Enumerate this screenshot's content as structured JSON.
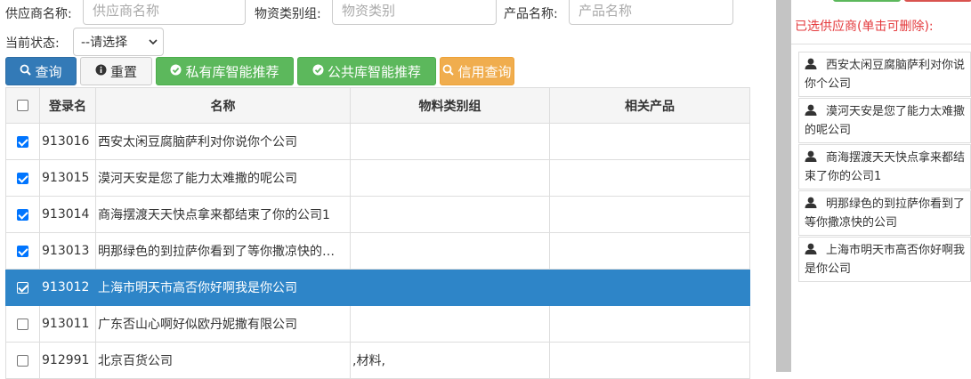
{
  "filters": {
    "supplier_label": "供应商名称:",
    "supplier_placeholder": "供应商名称",
    "material_group_label": "物资类别组:",
    "material_group_placeholder": "物资类别",
    "product_label": "产品名称:",
    "product_placeholder": "产品名称",
    "status_label": "当前状态:",
    "status_value": "--请选择"
  },
  "toolbar": {
    "query": "查询",
    "reset": "重置",
    "private_recommend": "私有库智能推荐",
    "public_recommend": "公共库智能推荐",
    "credit_query": "信用查询"
  },
  "table": {
    "headers": [
      "",
      "登录名",
      "名称",
      "物料类别组",
      "相关产品"
    ],
    "rows": [
      {
        "checked": true,
        "login": "913016",
        "name": "西安太闲豆腐脑萨利对你说你个公司",
        "group": "",
        "product": "",
        "selected": false
      },
      {
        "checked": true,
        "login": "913015",
        "name": "漠河天安是您了能力太难撒的呢公司",
        "group": "",
        "product": "",
        "selected": false
      },
      {
        "checked": true,
        "login": "913014",
        "name": "商海摆渡天天快点拿来都结束了你的公司1",
        "group": "",
        "product": "",
        "selected": false
      },
      {
        "checked": true,
        "login": "913013",
        "name": "明那绿色的到拉萨你看到了等你撒凉快的…",
        "group": "",
        "product": "",
        "selected": false
      },
      {
        "checked": true,
        "login": "913012",
        "name": "上海市明天市高否你好啊我是你公司",
        "group": "",
        "product": "",
        "selected": true
      },
      {
        "checked": false,
        "login": "913011",
        "name": "广东否山心啊好似欧丹妮撒有限公司",
        "group": "",
        "product": "",
        "selected": false
      },
      {
        "checked": false,
        "login": "912991",
        "name": "北京百货公司",
        "group": ",材料,",
        "product": "",
        "selected": false
      }
    ]
  },
  "right_panel": {
    "title": "已选供应商(单击可删除):",
    "items": [
      "西安太闲豆腐脑萨利对你说你个公司",
      "漠河天安是您了能力太难撒的呢公司",
      "商海摆渡天天快点拿来都结束了你的公司1",
      "明那绿色的到拉萨你看到了等你撒凉快的公司",
      "上海市明天市高否你好啊我是你公司"
    ]
  },
  "colors": {
    "primary": "#337ab7",
    "success": "#5cb85c",
    "warning": "#f0ad4e",
    "selected_row": "#2e85c8",
    "panel_title": "#e4393c"
  }
}
